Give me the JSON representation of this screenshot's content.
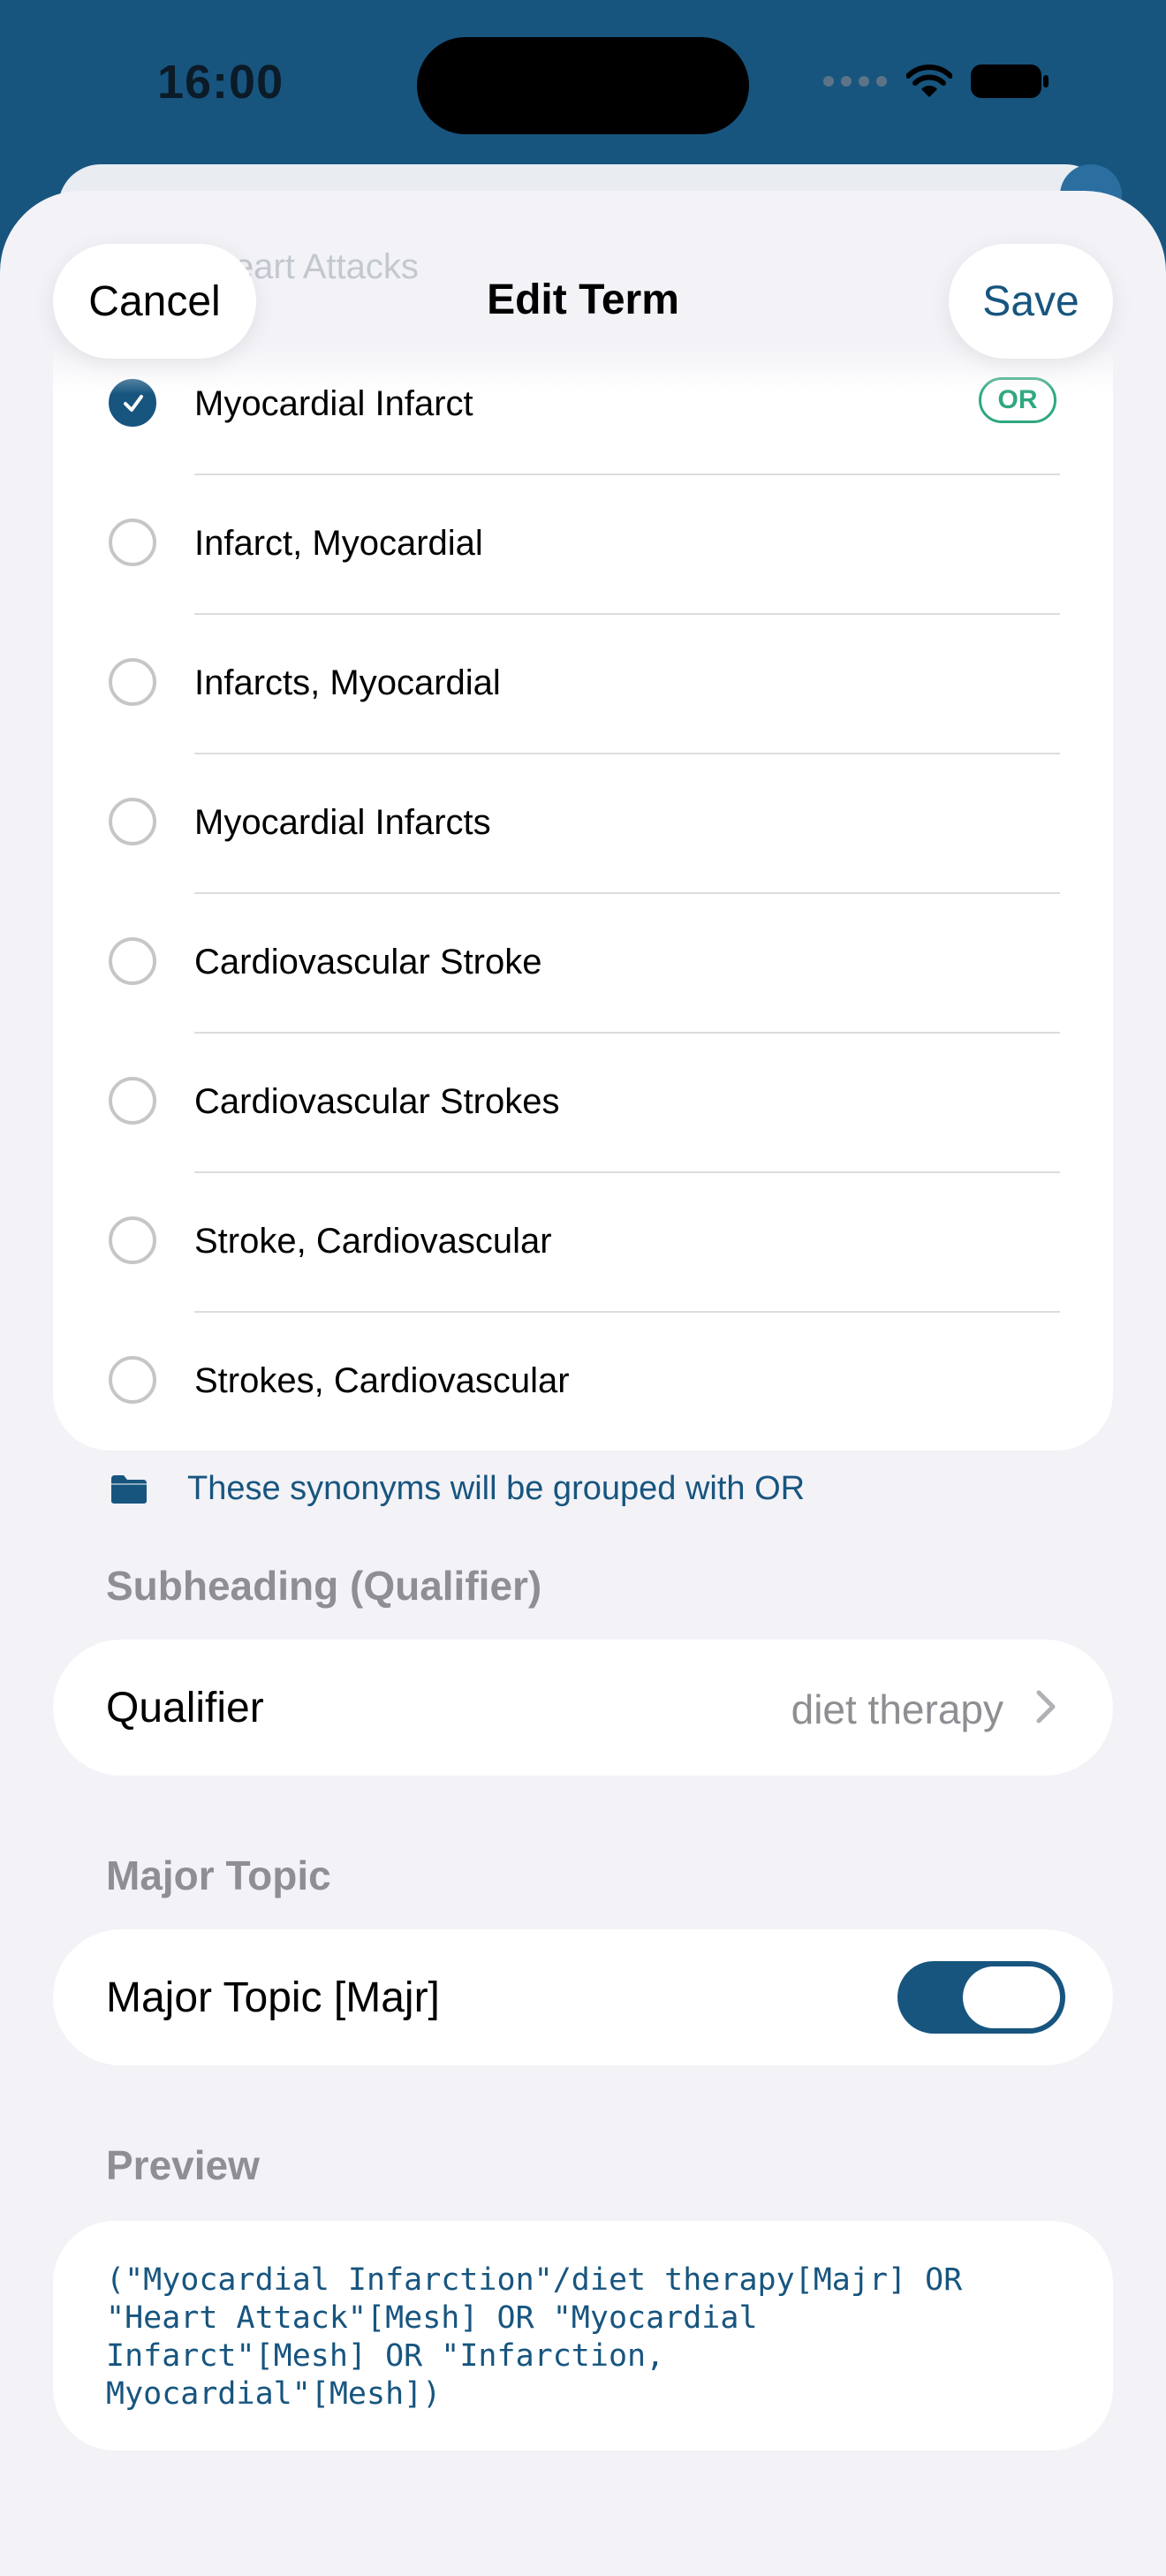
{
  "status_bar": {
    "time": "16:00"
  },
  "background": {
    "card_title": "Heart Attacks"
  },
  "nav": {
    "cancel_label": "Cancel",
    "title": "Edit Term",
    "save_label": "Save"
  },
  "synonyms": {
    "items": [
      {
        "label": "Myocardial Infarct",
        "selected": true,
        "badge": "OR"
      },
      {
        "label": "Infarct, Myocardial",
        "selected": false
      },
      {
        "label": "Infarcts, Myocardial",
        "selected": false
      },
      {
        "label": "Myocardial Infarcts",
        "selected": false
      },
      {
        "label": "Cardiovascular Stroke",
        "selected": false
      },
      {
        "label": "Cardiovascular Strokes",
        "selected": false
      },
      {
        "label": "Stroke, Cardiovascular",
        "selected": false
      },
      {
        "label": "Strokes, Cardiovascular",
        "selected": false
      }
    ],
    "footnote": "These synonyms will be grouped with OR"
  },
  "subheading": {
    "header": "Subheading (Qualifier)",
    "label": "Qualifier",
    "value": "diet therapy"
  },
  "major_topic": {
    "header": "Major Topic",
    "label": "Major Topic [Majr]",
    "enabled": true
  },
  "preview": {
    "header": "Preview",
    "query": "(\"Myocardial Infarction\"/diet therapy[Majr] OR\n\"Heart Attack\"[Mesh] OR \"Myocardial\nInfarct\"[Mesh] OR \"Infarction,\nMyocardial\"[Mesh])"
  },
  "colors": {
    "accent": "#17557f",
    "or_badge": "#2fa87e",
    "secondary_text": "#8e8e93"
  }
}
